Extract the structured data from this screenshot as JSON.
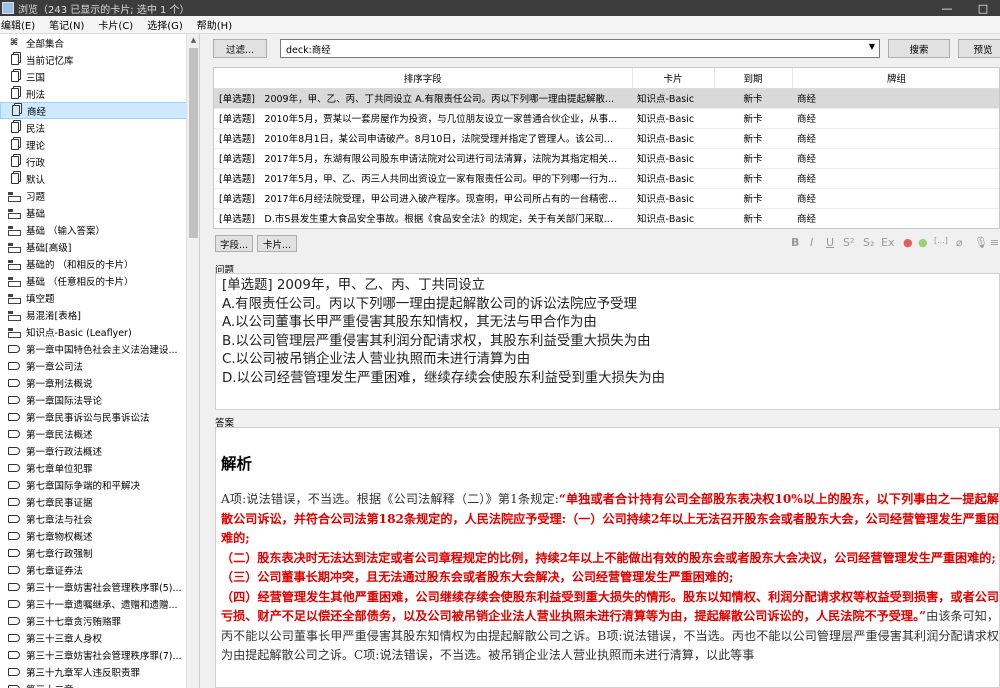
{
  "window": {
    "title": "浏览（243 已显示的卡片; 选中 1 个）",
    "minimize_glyph": "—",
    "maximize_glyph": "□"
  },
  "menu": [
    "编辑(E)",
    "笔记(N)",
    "卡片(C)",
    "选择(G)",
    "帮助(H)"
  ],
  "sidebar": {
    "items": [
      {
        "label": "全部集合",
        "icon": "collection-icon"
      },
      {
        "label": "当前记忆库",
        "icon": "deck-icon"
      },
      {
        "label": "三国",
        "icon": "deck-icon"
      },
      {
        "label": "刑法",
        "icon": "deck-icon"
      },
      {
        "label": "商经",
        "icon": "deck-icon",
        "selected": true
      },
      {
        "label": "民法",
        "icon": "deck-icon"
      },
      {
        "label": "理论",
        "icon": "deck-icon"
      },
      {
        "label": "行政",
        "icon": "deck-icon"
      },
      {
        "label": "默认",
        "icon": "deck-icon"
      },
      {
        "label": "习题",
        "icon": "note-type-icon"
      },
      {
        "label": "基础",
        "icon": "note-type-icon"
      },
      {
        "label": "基础 （输入答案）",
        "icon": "note-type-icon"
      },
      {
        "label": "基础[高级]",
        "icon": "note-type-icon"
      },
      {
        "label": "基础的 （和相反的卡片）",
        "icon": "note-type-icon"
      },
      {
        "label": "基础 （任意相反的卡片）",
        "icon": "note-type-icon"
      },
      {
        "label": "填空题",
        "icon": "note-type-icon"
      },
      {
        "label": "易混淆[表格]",
        "icon": "note-type-icon"
      },
      {
        "label": "知识点-Basic (Leaflyer)",
        "icon": "note-type-icon"
      },
      {
        "label": "第一章中国特色社会主义法治建设...",
        "icon": "tag-icon"
      },
      {
        "label": "第一章公司法",
        "icon": "tag-icon"
      },
      {
        "label": "第一章刑法概说",
        "icon": "tag-icon"
      },
      {
        "label": "第一章国际法导论",
        "icon": "tag-icon"
      },
      {
        "label": "第一章民事诉讼与民事诉讼法",
        "icon": "tag-icon"
      },
      {
        "label": "第一章民法概述",
        "icon": "tag-icon"
      },
      {
        "label": "第一章行政法概述",
        "icon": "tag-icon"
      },
      {
        "label": "第七章单位犯罪",
        "icon": "tag-icon"
      },
      {
        "label": "第七章国际争端的和平解决",
        "icon": "tag-icon"
      },
      {
        "label": "第七章民事证据",
        "icon": "tag-icon"
      },
      {
        "label": "第七章法与社会",
        "icon": "tag-icon"
      },
      {
        "label": "第七章物权概述",
        "icon": "tag-icon"
      },
      {
        "label": "第七章行政强制",
        "icon": "tag-icon"
      },
      {
        "label": "第七章证券法",
        "icon": "tag-icon"
      },
      {
        "label": "第三十一章妨害社会管理秩序罪(5)...",
        "icon": "tag-icon"
      },
      {
        "label": "第三十一章遗嘱继承、遗赠和遗赠...",
        "icon": "tag-icon"
      },
      {
        "label": "第三十七章贪污贿赂罪",
        "icon": "tag-icon"
      },
      {
        "label": "第三十三章人身权",
        "icon": "tag-icon"
      },
      {
        "label": "第三十三章妨害社会管理秩序罪(7)...",
        "icon": "tag-icon"
      },
      {
        "label": "第三十九章军人违反职责罪",
        "icon": "tag-icon"
      },
      {
        "label": "第三十二章",
        "icon": "tag-icon"
      }
    ]
  },
  "toolbar": {
    "filter_label": "过滤...",
    "search_value": "deck:商经",
    "search_label": "搜索",
    "preview_label": "预览"
  },
  "table": {
    "headers": [
      "排序字段",
      "卡片",
      "到期",
      "牌组"
    ],
    "rows": [
      [
        "[单选题]　2009年，甲、乙、丙、丁共同设立 A.有限责任公司。丙以下列哪一理由提起解散...",
        "知识点-Basic",
        "新卡",
        "商经"
      ],
      [
        "[单选题]　2010年5月，贾某以一套房屋作为投资，与几位朋友设立一家普通合伙企业，从事...",
        "知识点-Basic",
        "新卡",
        "商经"
      ],
      [
        "[单选题]　2010年8月1日，某公司申请破产。8月10日，法院受理并指定了管理人。该公司...",
        "知识点-Basic",
        "新卡",
        "商经"
      ],
      [
        "[单选题]　2017年5月，东湖有限公司股东申请法院对公司进行司法清算，法院为其指定相关...",
        "知识点-Basic",
        "新卡",
        "商经"
      ],
      [
        "[单选题]　2017年5月，甲、乙、丙三人共同出资设立一家有限责任公司。甲的下列哪一行为...",
        "知识点-Basic",
        "新卡",
        "商经"
      ],
      [
        "[单选题]　2017年6月经法院受理，甲公司进入破产程序。现查明，甲公司所占有的一台精密...",
        "知识点-Basic",
        "新卡",
        "商经"
      ],
      [
        "[单选题]　D.市S县发生重大食品安全事故。根据《食品安全法》的规定，关于有关部门采取...",
        "知识点-Basic",
        "新卡",
        "商经"
      ]
    ]
  },
  "editor": {
    "fields_label": "字段...",
    "cards_label": "卡片...",
    "format_icons": [
      {
        "name": "bold-icon",
        "glyph": "B"
      },
      {
        "name": "italic-icon",
        "glyph": "I"
      },
      {
        "name": "underline-icon",
        "glyph": "U"
      },
      {
        "name": "superscript-icon",
        "glyph": "S²"
      },
      {
        "name": "subscript-icon",
        "glyph": "S₂"
      },
      {
        "name": "clear-format-icon",
        "glyph": "Ex"
      },
      {
        "name": "text-color-icon",
        "glyph": "●"
      },
      {
        "name": "highlight-color-icon",
        "glyph": "●"
      },
      {
        "name": "cloze-icon",
        "glyph": "[...]"
      },
      {
        "name": "attach-icon",
        "glyph": "⌀"
      },
      {
        "name": "record-audio-icon",
        "glyph": "🎙"
      },
      {
        "name": "more-icon",
        "glyph": "≡"
      }
    ],
    "question_label": "问题",
    "question_lines": [
      "[单选题] 2009年，甲、乙、丙、丁共同设立",
      "A.有限责任公司。丙以下列哪一理由提起解散公司的诉讼法院应予受理",
      "A.以公司董事长甲严重侵害其股东知情权，其无法与甲合作为由",
      "B.以公司管理层严重侵害其利润分配请求权，其股东利益受重大损失为由",
      "C.以公司被吊销企业法人营业执照而未进行清算为由",
      "D.以公司经营管理发生严重困难，继续存续会使股东利益受到重大损失为由"
    ],
    "answer_label": "答案",
    "answer_heading": "解析",
    "answer_intro": "A项:说法错误，不当选。根据《公司法解释（二）》第1条规定:",
    "answer_quote_lines": [
      "“单独或者合计持有公司全部股东表决权10%以上的股东，以下列事由之一提起解散公司诉讼，并符合公司法第182条规定的，人民法院应予受理:（一）公司持续2年以上无法召开股东会或者股东大会，公司经营管理发生严重困难的;",
      "（二）股东表决时无法达到法定或者公司章程规定的比例，持续2年以上不能做出有效的股东会或者股东大会决议，公司经营管理发生严重困难的;",
      "（三）公司董事长期冲突，且无法通过股东会或者股东大会解决，公司经营管理发生严重困难的;",
      "（四）经营管理发生其他严重困难，公司继续存续会使股东利益受到重大损失的情形。股东以知情权、利润分配请求权等权益受到损害，或者公司亏损、财产不足以偿还全部债务，以及公司被吊销企业法人营业执照未进行清算等为由，提起解散公司诉讼的，人民法院不予受理。”"
    ],
    "answer_tail": "由该条可知，丙不能以公司董事长甲严重侵害其股东知情权为由提起解散公司之诉。B项:说法错误，不当选。丙也不能以公司管理层严重侵害其利润分配请求权为由提起解散公司之诉。C项:说法错误，不当选。被吊销企业法人营业执照而未进行清算，以此等事"
  }
}
